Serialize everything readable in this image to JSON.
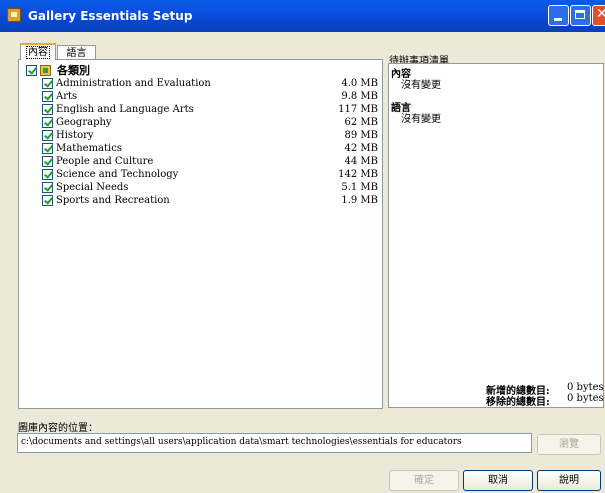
{
  "window": {
    "title": "Gallery Essentials Setup"
  },
  "tabs": [
    {
      "label": "內容",
      "active": true
    },
    {
      "label": "語言",
      "active": false
    }
  ],
  "tree": {
    "root_label": "各類別",
    "items": [
      {
        "label": "Administration and Evaluation",
        "size": "4.0 MB",
        "checked": true
      },
      {
        "label": "Arts",
        "size": "9.8 MB",
        "checked": true
      },
      {
        "label": "English and Language Arts",
        "size": "117 MB",
        "checked": true
      },
      {
        "label": "Geography",
        "size": "62 MB",
        "checked": true
      },
      {
        "label": "History",
        "size": "89 MB",
        "checked": true
      },
      {
        "label": "Mathematics",
        "size": "42 MB",
        "checked": true
      },
      {
        "label": "People and Culture",
        "size": "44 MB",
        "checked": true
      },
      {
        "label": "Science and Technology",
        "size": "142 MB",
        "checked": true
      },
      {
        "label": "Special Needs",
        "size": "5.1 MB",
        "checked": true
      },
      {
        "label": "Sports and Recreation",
        "size": "1.9 MB",
        "checked": true
      }
    ]
  },
  "pending": {
    "title": "待辦事項清單",
    "content_heading": "內容",
    "content_status": "沒有變更",
    "language_heading": "語言",
    "language_status": "沒有變更",
    "added_label": "新增的總數目:",
    "added_value": "0 bytes",
    "removed_label": "移除的總數目:",
    "removed_value": "0 bytes"
  },
  "location": {
    "label": "圖庫內容的位置：",
    "path": "c:\\documents and settings\\all users\\application data\\smart technologies\\essentials for educators",
    "browse_label": "瀏覽"
  },
  "buttons": {
    "ok": "確定",
    "cancel": "取消",
    "help": "說明"
  }
}
